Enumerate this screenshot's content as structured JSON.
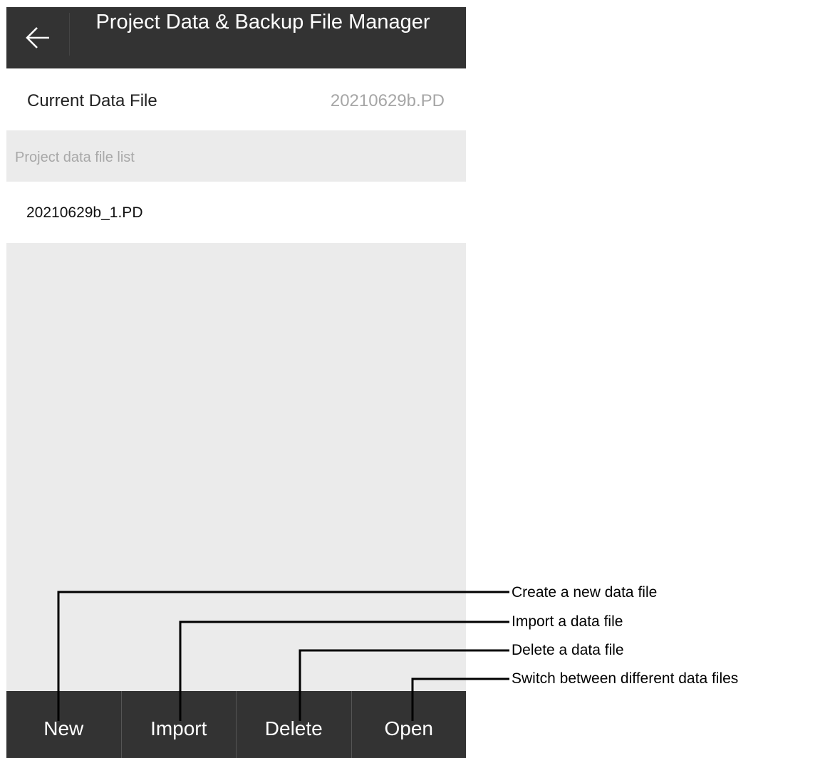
{
  "app": {
    "title": "Project Data & Backup File Manager",
    "back_icon": "arrow-left-icon"
  },
  "current": {
    "label": "Current Data File",
    "value": "20210629b.PD"
  },
  "list": {
    "header": "Project data file list",
    "items": [
      "20210629b_1.PD"
    ]
  },
  "toolbar": {
    "new_label": "New",
    "import_label": "Import",
    "delete_label": "Delete",
    "open_label": "Open"
  },
  "annotations": {
    "new": "Create a new data file",
    "import": "Import a data file",
    "delete": "Delete a  data file",
    "open": "Switch between different data files"
  },
  "colors": {
    "appbar": "#333333",
    "background": "#ebebeb",
    "muted_text": "#a6a6a6"
  }
}
